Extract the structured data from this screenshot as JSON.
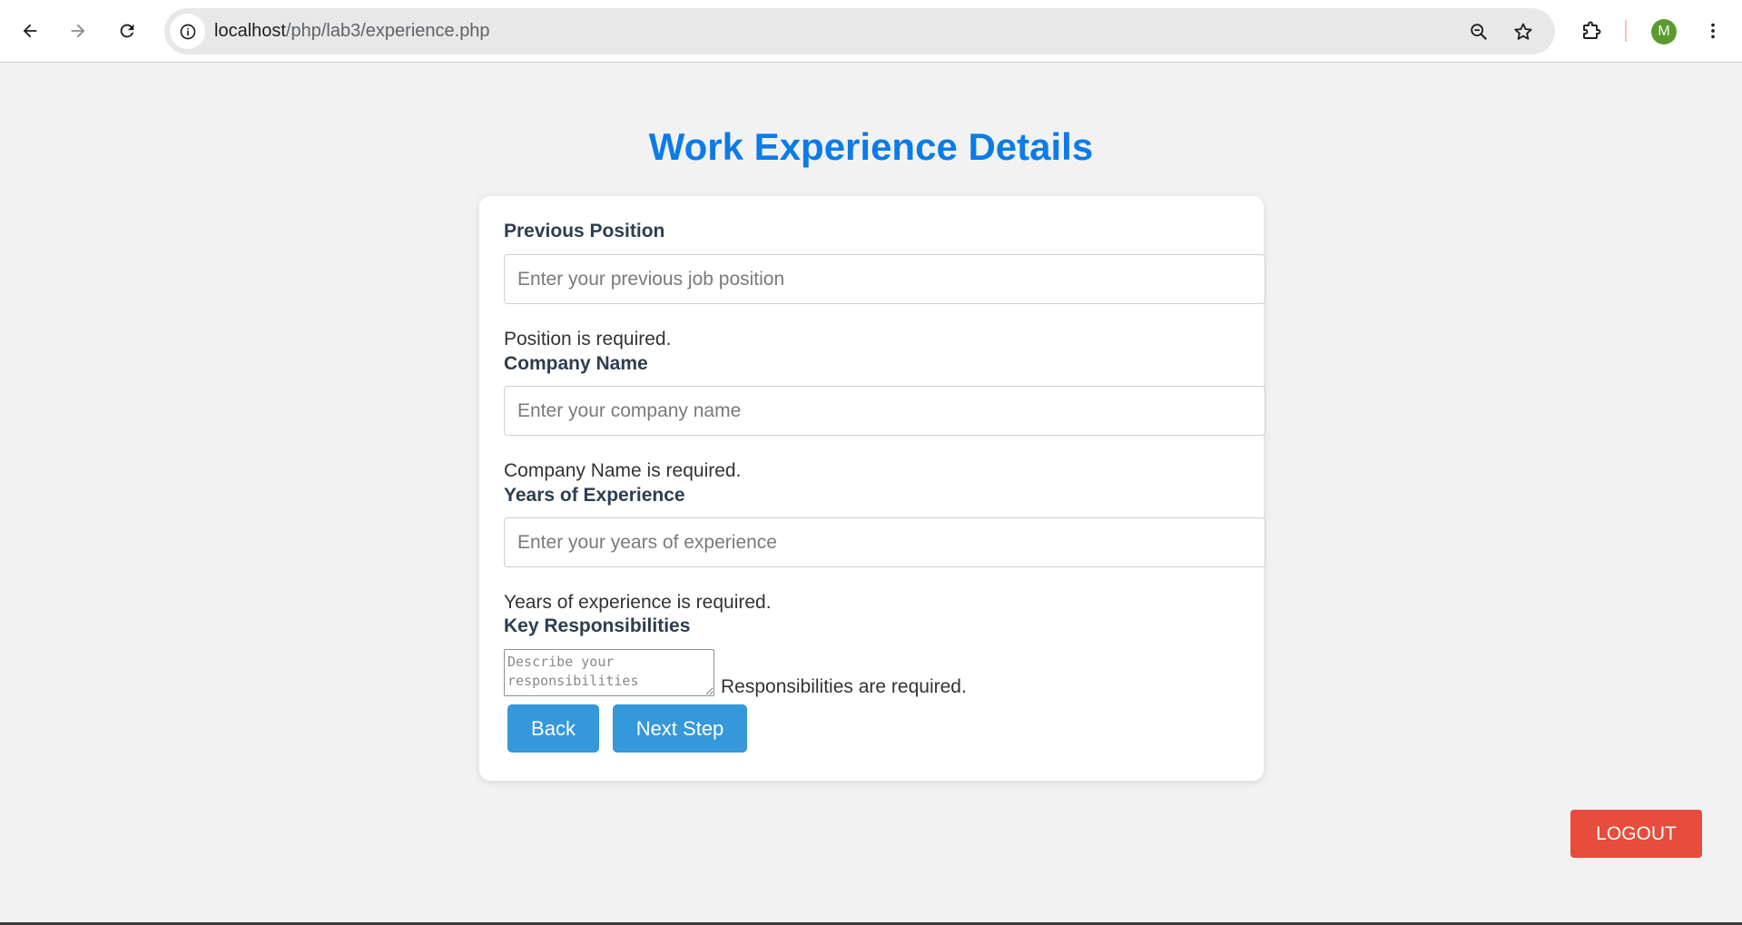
{
  "browser": {
    "url_host": "localhost",
    "url_path": "/php/lab3/experience.php",
    "avatar_letter": "M"
  },
  "page": {
    "title": "Work Experience Details"
  },
  "form": {
    "position": {
      "label": "Previous Position",
      "placeholder": "Enter your previous job position",
      "value": "",
      "error": "Position is required."
    },
    "company": {
      "label": "Company Name",
      "placeholder": "Enter your company name",
      "value": "",
      "error": "Company Name is required."
    },
    "years": {
      "label": "Years of Experience",
      "placeholder": "Enter your years of experience",
      "value": "",
      "error": "Years of experience is required."
    },
    "responsibilities": {
      "label": "Key Responsibilities",
      "placeholder": "Describe your responsibilities",
      "value": "",
      "error": "Responsibilities are required."
    },
    "back_label": "Back",
    "next_label": "Next Step"
  },
  "logout_label": "LOGOUT",
  "colors": {
    "title": "#0b7be8",
    "primary_button": "#3498db",
    "logout_button": "#e74c3c",
    "label": "#2c3e50"
  },
  "icons": {
    "back": "arrow-left",
    "forward": "arrow-right",
    "reload": "reload",
    "site_info": "info",
    "zoom": "zoom-out",
    "bookmark": "star",
    "extensions": "puzzle",
    "menu": "three-dots-vertical"
  }
}
